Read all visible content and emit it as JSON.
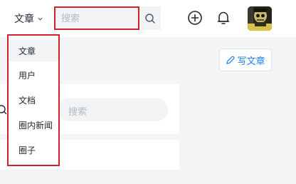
{
  "header": {
    "type_select": {
      "label": "文章"
    },
    "search": {
      "placeholder": "搜索"
    }
  },
  "dropdown": {
    "items": [
      {
        "label": "文章"
      },
      {
        "label": "用户"
      },
      {
        "label": "文档"
      },
      {
        "label": "圈内新闻"
      },
      {
        "label": "圈子"
      }
    ]
  },
  "toolbar": {
    "write_label": "写文章"
  },
  "background": {
    "search_placeholder": "搜索"
  },
  "colors": {
    "highlight_border": "#d1242a",
    "accent": "#1e80ff",
    "page_bg": "#f4f5f7",
    "search_bg": "#f2f3f5"
  },
  "icons": {
    "chevron": "chevron-down-icon",
    "search": "search-icon",
    "add": "plus-circle-icon",
    "notifications": "bell-icon",
    "write": "pen-icon"
  }
}
